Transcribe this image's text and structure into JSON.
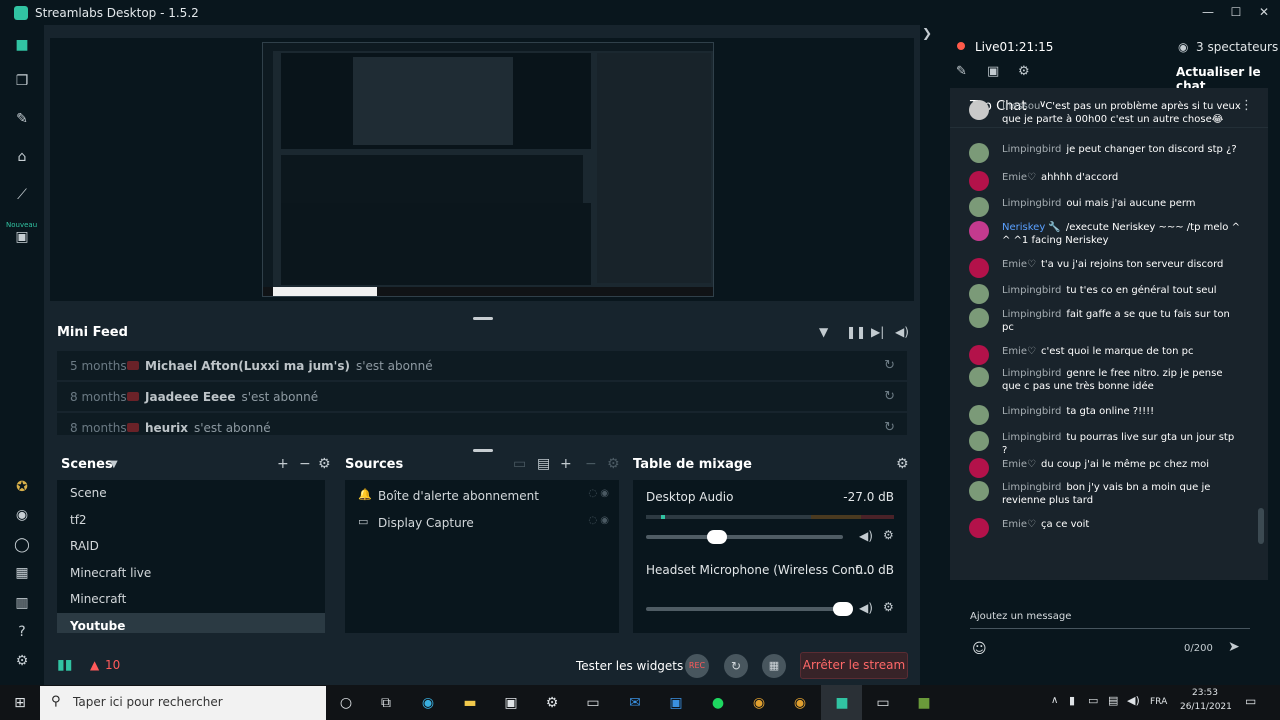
{
  "window": {
    "title": "Streamlabs Desktop - 1.5.2",
    "controls": [
      "—",
      "☐",
      "✕"
    ]
  },
  "nav": {
    "nouveau": "Nouveau"
  },
  "minifeed": {
    "title": "Mini Feed",
    "rows": [
      {
        "age": "5 months",
        "name": "Michael Afton(Luxxi ma jum's)",
        "event": "s'est abonné"
      },
      {
        "age": "8 months",
        "name": "Jaadeee Eeee",
        "event": "s'est abonné"
      },
      {
        "age": "8 months",
        "name": "heurix",
        "event": "s'est abonné"
      }
    ]
  },
  "scenes": {
    "title": "Scenes",
    "items": [
      "Scene",
      "tf2",
      "RAID",
      "Minecraft live",
      "Minecraft",
      "Youtube"
    ],
    "selected": "Youtube"
  },
  "sources": {
    "title": "Sources",
    "items": [
      {
        "label": "Boîte d'alerte abonnement",
        "icon": "bell-icon"
      },
      {
        "label": "Display Capture",
        "icon": "monitor-icon"
      }
    ]
  },
  "mixer": {
    "title": "Table de mixage",
    "channels": [
      {
        "name": "Desktop Audio",
        "db": "-27.0 dB",
        "level": 0.36
      },
      {
        "name": "Headset Microphone (Wireless Cont...",
        "db": "0.0 dB",
        "level": 1.0
      }
    ]
  },
  "footer": {
    "warnings": "10",
    "tester": "Tester les widgets",
    "rec": "REC",
    "stop": "Arrêter le stream"
  },
  "chat": {
    "live_label": "Live",
    "live_time": "01:21:15",
    "viewers": "3 spectateurs",
    "refresh": "Actualiser le chat",
    "top_chat": "Top Chat",
    "input_placeholder": "Ajoutez un message",
    "counter": "0/200",
    "messages": [
      {
        "user": "Inessou",
        "text": "C'est pas un problème après si tu veux que je parte à 00h00 c'est un autre chose😂",
        "color": "#c9c9c9"
      },
      {
        "user": "Limpingbird",
        "text": "je peut changer ton discord stp ¿?",
        "color": "#7b9a78"
      },
      {
        "user": "Emie♡",
        "text": "ahhhh d'accord",
        "color": "#b3124a"
      },
      {
        "user": "Limpingbird",
        "text": "oui mais j'ai aucune perm",
        "color": "#7b9a78"
      },
      {
        "user": "Neriskey 🔧",
        "text": "/execute Neriskey ~~~ /tp melo ^ ^ ^1 facing Neriskey",
        "color": "#c43a8e"
      },
      {
        "user": "Emie♡",
        "text": "t'a vu j'ai rejoins ton serveur discord",
        "color": "#b3124a"
      },
      {
        "user": "Limpingbird",
        "text": "tu t'es co en général tout seul",
        "color": "#7b9a78"
      },
      {
        "user": "Limpingbird",
        "text": "fait gaffe a se que tu fais sur ton pc",
        "color": "#7b9a78"
      },
      {
        "user": "Emie♡",
        "text": "c'est quoi le marque de ton pc",
        "color": "#b3124a"
      },
      {
        "user": "Limpingbird",
        "text": "genre le free nitro. zip je pense que c pas une très bonne idée",
        "color": "#7b9a78"
      },
      {
        "user": "Limpingbird",
        "text": "ta gta online ?!!!!",
        "color": "#7b9a78"
      },
      {
        "user": "Limpingbird",
        "text": "tu pourras live sur gta un jour stp ?",
        "color": "#7b9a78"
      },
      {
        "user": "Emie♡",
        "text": "du coup j'ai le même pc chez moi",
        "color": "#b3124a"
      },
      {
        "user": "Limpingbird",
        "text": "bon j'y vais bn a moin que je revienne plus tard",
        "color": "#7b9a78"
      },
      {
        "user": "Emie♡",
        "text": "ça ce voit",
        "color": "#b3124a"
      }
    ]
  },
  "taskbar": {
    "search_placeholder": "Taper ici pour rechercher",
    "lang": "FRA",
    "time": "23:53",
    "date": "26/11/2021"
  }
}
